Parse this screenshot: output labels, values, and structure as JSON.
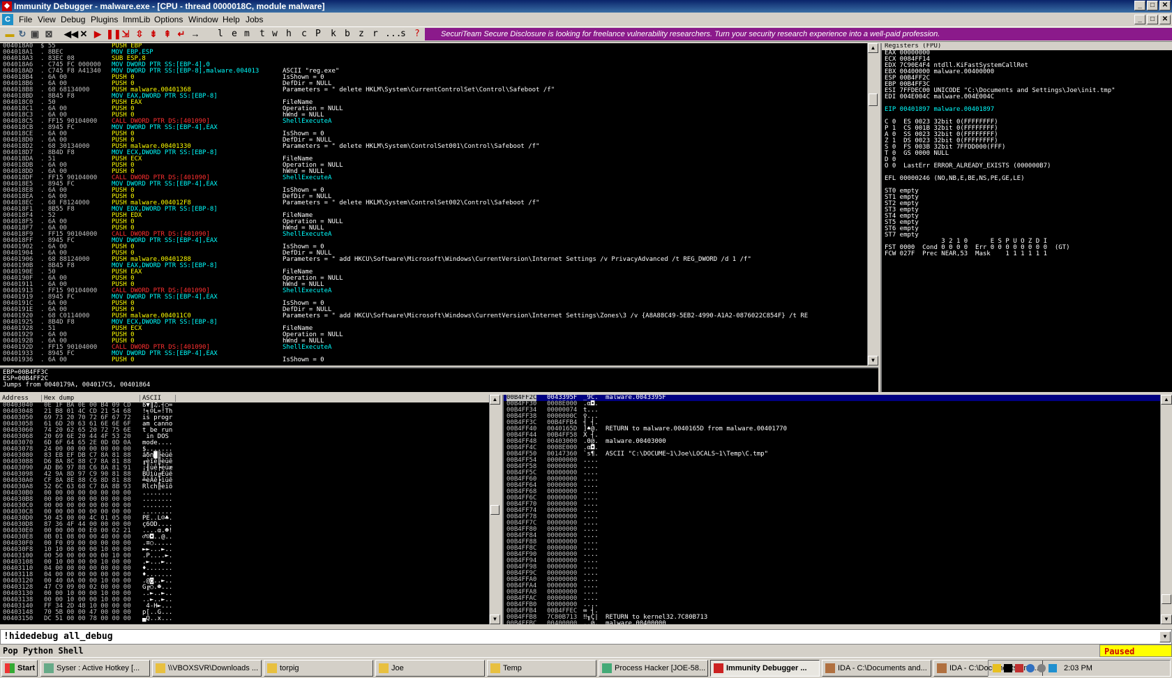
{
  "window": {
    "title": "Immunity Debugger - malware.exe - [CPU - thread 0000018C, module malware]",
    "logo": "C"
  },
  "menu": [
    "File",
    "View",
    "Debug",
    "Plugins",
    "ImmLib",
    "Options",
    "Window",
    "Help",
    "Jobs"
  ],
  "toolbar_letters": [
    "l",
    "e",
    "m",
    "t",
    "w",
    "h",
    "c",
    "P",
    "k",
    "b",
    "z",
    "r",
    "...",
    "s",
    "?"
  ],
  "banner": "SecuriTeam Secure Disclosure is looking for freelance vulnerability researchers. Turn your security research experience into a well-paid profession.",
  "colors": {
    "addr": "#c0c0c0",
    "hex": "#c0c0c0",
    "mnem": "#ffff00",
    "call": "#ff3030",
    "ref": "#00ffff",
    "comment": "#ffffff",
    "highlight_bg": "#000080",
    "registers": "#ffffff"
  },
  "disasm": [
    [
      "004018A0",
      "$ 55",
      "PUSH EBP",
      ""
    ],
    [
      "004018A1",
      ". 8BEC",
      "MOV EBP,ESP",
      ""
    ],
    [
      "004018A3",
      ". 83EC 08",
      "SUB ESP,8",
      ""
    ],
    [
      "004018A6",
      ". C745 FC 000000",
      "MOV DWORD PTR SS:[EBP-4],0",
      ""
    ],
    [
      "004018AD",
      ". C745 F8 A41340",
      "MOV DWORD PTR SS:[EBP-8],malware.004013",
      "ASCII \"reg.exe\""
    ],
    [
      "004018B4",
      ". 6A 00",
      "PUSH 0",
      "IsShown = 0"
    ],
    [
      "004018B6",
      ". 6A 00",
      "PUSH 0",
      "DefDir = NULL"
    ],
    [
      "004018B8",
      ". 68 68134000",
      "PUSH malware.00401368",
      "Parameters = \" delete HKLM\\System\\CurrentControlSet\\Control\\Safeboot /f\""
    ],
    [
      "004018BD",
      ". 8B45 F8",
      "MOV EAX,DWORD PTR SS:[EBP-8]",
      ""
    ],
    [
      "004018C0",
      ". 50",
      "PUSH EAX",
      "FileName"
    ],
    [
      "004018C1",
      ". 6A 00",
      "PUSH 0",
      "Operation = NULL"
    ],
    [
      "004018C3",
      ". 6A 00",
      "PUSH 0",
      "hWnd = NULL"
    ],
    [
      "004018C5",
      ". FF15 90104000",
      "CALL DWORD PTR DS:[401090]",
      "ShellExecuteA"
    ],
    [
      "004018CB",
      ". 8945 FC",
      "MOV DWORD PTR SS:[EBP-4],EAX",
      ""
    ],
    [
      "004018CE",
      ". 6A 00",
      "PUSH 0",
      "IsShown = 0"
    ],
    [
      "004018D0",
      ". 6A 00",
      "PUSH 0",
      "DefDir = NULL"
    ],
    [
      "004018D2",
      ". 68 30134000",
      "PUSH malware.00401330",
      "Parameters = \" delete HKLM\\System\\ControlSet001\\Control\\Safeboot /f\""
    ],
    [
      "004018D7",
      ". 8B4D F8",
      "MOV ECX,DWORD PTR SS:[EBP-8]",
      ""
    ],
    [
      "004018DA",
      ". 51",
      "PUSH ECX",
      "FileName"
    ],
    [
      "004018DB",
      ". 6A 00",
      "PUSH 0",
      "Operation = NULL"
    ],
    [
      "004018DD",
      ". 6A 00",
      "PUSH 0",
      "hWnd = NULL"
    ],
    [
      "004018DF",
      ". FF15 90104000",
      "CALL DWORD PTR DS:[401090]",
      "ShellExecuteA"
    ],
    [
      "004018E5",
      ". 8945 FC",
      "MOV DWORD PTR SS:[EBP-4],EAX",
      ""
    ],
    [
      "004018E8",
      ". 6A 00",
      "PUSH 0",
      "IsShown = 0"
    ],
    [
      "004018EA",
      ". 6A 00",
      "PUSH 0",
      "DefDir = NULL"
    ],
    [
      "004018EC",
      ". 68 F8124000",
      "PUSH malware.004012F8",
      "Parameters = \" delete HKLM\\System\\ControlSet002\\Control\\Safeboot /f\""
    ],
    [
      "004018F1",
      ". 8B55 F8",
      "MOV EDX,DWORD PTR SS:[EBP-8]",
      ""
    ],
    [
      "004018F4",
      ". 52",
      "PUSH EDX",
      "FileName"
    ],
    [
      "004018F5",
      ". 6A 00",
      "PUSH 0",
      "Operation = NULL"
    ],
    [
      "004018F7",
      ". 6A 00",
      "PUSH 0",
      "hWnd = NULL"
    ],
    [
      "004018F9",
      ". FF15 90104000",
      "CALL DWORD PTR DS:[401090]",
      "ShellExecuteA"
    ],
    [
      "004018FF",
      ". 8945 FC",
      "MOV DWORD PTR SS:[EBP-4],EAX",
      ""
    ],
    [
      "00401902",
      ". 6A 00",
      "PUSH 0",
      "IsShown = 0"
    ],
    [
      "00401904",
      ". 6A 00",
      "PUSH 0",
      "DefDir = NULL"
    ],
    [
      "00401906",
      ". 68 88124000",
      "PUSH malware.00401288",
      "Parameters = \" add HKCU\\Software\\Microsoft\\Windows\\CurrentVersion\\Internet Settings /v PrivacyAdvanced /t REG_DWORD /d 1 /f\""
    ],
    [
      "0040190B",
      ". 8B45 F8",
      "MOV EAX,DWORD PTR SS:[EBP-8]",
      ""
    ],
    [
      "0040190E",
      ". 50",
      "PUSH EAX",
      "FileName"
    ],
    [
      "0040190F",
      ". 6A 00",
      "PUSH 0",
      "Operation = NULL"
    ],
    [
      "00401911",
      ". 6A 00",
      "PUSH 0",
      "hWnd = NULL"
    ],
    [
      "00401913",
      ". FF15 90104000",
      "CALL DWORD PTR DS:[401090]",
      "ShellExecuteA"
    ],
    [
      "00401919",
      ". 8945 FC",
      "MOV DWORD PTR SS:[EBP-4],EAX",
      ""
    ],
    [
      "0040191C",
      ". 6A 00",
      "PUSH 0",
      "IsShown = 0"
    ],
    [
      "0040191E",
      ". 6A 00",
      "PUSH 0",
      "DefDir = NULL"
    ],
    [
      "00401920",
      ". 68 C0114000",
      "PUSH malware.004011C0",
      "Parameters = \" add HKCU\\Software\\Microsoft\\Windows\\CurrentVersion\\Internet Settings\\Zones\\3 /v {A8A88C49-5EB2-4990-A1A2-0876022C854F} /t RE"
    ],
    [
      "00401925",
      ". 8B4D F8",
      "MOV ECX,DWORD PTR SS:[EBP-8]",
      ""
    ],
    [
      "00401928",
      ". 51",
      "PUSH ECX",
      "FileName"
    ],
    [
      "00401929",
      ". 6A 00",
      "PUSH 0",
      "Operation = NULL"
    ],
    [
      "0040192B",
      ". 6A 00",
      "PUSH 0",
      "hWnd = NULL"
    ],
    [
      "0040192D",
      ". FF15 90104000",
      "CALL DWORD PTR DS:[401090]",
      "ShellExecuteA"
    ],
    [
      "00401933",
      ". 8945 FC",
      "MOV DWORD PTR SS:[EBP-4],EAX",
      ""
    ],
    [
      "00401936",
      ". 6A 00",
      "PUSH 0",
      "IsShown = 0"
    ]
  ],
  "info": [
    "EBP=00B4FF3C",
    "ESP=00B4FF2C",
    "Jumps from 0040179A, 004017C5, 00401864"
  ],
  "registers_title": "Registers (FPU)",
  "registers": [
    "EAX 00000000",
    "ECX 0084FF14",
    "EDX 7C90E4F4 ntdll.KiFastSystemCallRet",
    "EBX 00400000 malware.00400000",
    "ESP 00B4FF2C",
    "EBP 00B4FF3C",
    "ESI 7FFDEC00 UNICODE \"C:\\Documents and Settings\\Joe\\init.tmp\"",
    "EDI 004E004C malware.004E004C",
    "",
    "EIP 00401897 malware.00401897",
    "",
    "C 0  ES 0023 32bit 0(FFFFFFFF)",
    "P 1  CS 001B 32bit 0(FFFFFFFF)",
    "A 0  SS 0023 32bit 0(FFFFFFFF)",
    "Z 1  DS 0023 32bit 0(FFFFFFFF)",
    "S 0  FS 003B 32bit 7FFDD000(FFF)",
    "T 0  GS 0000 NULL",
    "D 0",
    "O 0  LastErr ERROR_ALREADY_EXISTS (000000B7)",
    "",
    "EFL 00000246 (NO,NB,E,BE,NS,PE,GE,LE)",
    "",
    "ST0 empty",
    "ST1 empty",
    "ST2 empty",
    "ST3 empty",
    "ST4 empty",
    "ST5 empty",
    "ST6 empty",
    "ST7 empty",
    "               3 2 1 0      E S P U O Z D I",
    "FST 0000  Cond 0 0 0 0  Err 0 0 0 0 0 0 0 0  (GT)",
    "FCW 027F  Prec NEAR,53  Mask    1 1 1 1 1 1"
  ],
  "dump_headers": [
    "Address",
    "Hex dump",
    "ASCII"
  ],
  "dump": [
    [
      "00403040",
      "0E 1F BA 0E 00 B4 09 CD",
      "ß▼║♫.┤○="
    ],
    [
      "00403048",
      "21 B8 01 4C CD 21 54 68",
      "!╕☺L=!Th"
    ],
    [
      "00403050",
      "69 73 20 70 72 6F 67 72",
      "is progr"
    ],
    [
      "00403058",
      "61 6D 20 63 61 6E 6E 6F",
      "am canno"
    ],
    [
      "00403060",
      "74 20 62 65 20 72 75 6E",
      "t be run"
    ],
    [
      "00403068",
      "20 69 6E 20 44 4F 53 20",
      " in DOS "
    ],
    [
      "00403070",
      "6D 6F 64 65 2E 0D 0D 0A",
      "mode...."
    ],
    [
      "00403078",
      "24 00 00 00 00 00 00 00",
      "$......."
    ],
    [
      "00403080",
      "83 EB EF DB C7 8A 81 88",
      "âδ∩█╟èüê"
    ],
    [
      "00403088",
      "D6 8A 8C 88 C7 8A 81 88",
      "╓èîê╟èüê"
    ],
    [
      "00403090",
      "AD B6 97 88 C6 8A 81 91",
      "¡╢ùê╞èüæ"
    ],
    [
      "00403098",
      "42 9A 8D 97 C9 90 81 88",
      "BÜìù╔Éüê"
    ],
    [
      "004030A0",
      "CF 8A 8E 88 C6 8D 81 88",
      "╧èÄê╞ìüê"
    ],
    [
      "004030A8",
      "52 6C 63 68 C7 8A 8B 93",
      "Rlch╟èïô"
    ],
    [
      "004030B0",
      "00 00 00 00 00 00 00 00",
      "........"
    ],
    [
      "004030B8",
      "00 00 00 00 00 00 00 00",
      "........"
    ],
    [
      "004030C0",
      "00 00 00 00 00 00 00 00",
      "........"
    ],
    [
      "004030C8",
      "00 00 00 00 00 00 00 00",
      "........"
    ],
    [
      "004030D0",
      "50 45 00 00 4C 01 05 00",
      "PE..L☺♣."
    ],
    [
      "004030D8",
      "87 36 4F 44 00 00 00 00",
      "ç6OD...."
    ],
    [
      "004030E0",
      "00 00 00 00 E0 00 02 21",
      "....α.☻!"
    ],
    [
      "004030E8",
      "0B 01 08 00 00 40 00 00",
      "♂☺◘..@.."
    ],
    [
      "004030F0",
      "00 F0 09 00 00 00 00 00",
      ".≡○....."
    ],
    [
      "004030F8",
      "10 10 00 00 00 10 00 00",
      "►►...►.."
    ],
    [
      "00403100",
      "00 50 00 00 00 00 10 00",
      ".P....►."
    ],
    [
      "00403108",
      "00 10 00 00 00 10 00 00",
      ".►...►.."
    ],
    [
      "00403110",
      "04 00 00 00 00 00 00 00",
      "♦......."
    ],
    [
      "00403118",
      "04 00 00 00 00 00 00 00",
      "♦......."
    ],
    [
      "00403120",
      "00 40 0A 00 00 10 00 00",
      ".@◙..►.."
    ],
    [
      "00403128",
      "47 C9 09 00 02 00 00 00",
      "G╔○.☻..."
    ],
    [
      "00403130",
      "00 00 10 00 00 10 00 00",
      "..►..►.."
    ],
    [
      "00403138",
      "00 00 10 00 00 10 00 00",
      "..►..►.."
    ],
    [
      "00403140",
      "FF 34 2D 48 10 00 00 00",
      " 4-H►..."
    ],
    [
      "00403148",
      "70 5B 00 00 47 00 00 00",
      "p[..G..."
    ],
    [
      "00403150",
      "DC 51 00 00 78 00 00 00",
      "▄Q..x..."
    ]
  ],
  "stack": [
    [
      "00B4FF2C",
      "0043395F",
      "_9C.",
      "malware.0043395F"
    ],
    [
      "00B4FF30",
      "0008E000",
      ".α◘.",
      ""
    ],
    [
      "00B4FF34",
      "00000074",
      "t...",
      ""
    ],
    [
      "00B4FF38",
      "0000000C",
      "♀...",
      ""
    ],
    [
      "00B4FF3C",
      "00B4FFB4",
      "┤ ┤.",
      ""
    ],
    [
      "00B4FF40",
      "0040165D",
      "]♠@.",
      "RETURN to malware.0040165D from malware.00401770"
    ],
    [
      "00B4FF44",
      "00B4FF58",
      "X ┤.",
      ""
    ],
    [
      "00B4FF48",
      "00403000",
      ".0@.",
      "malware.00403000"
    ],
    [
      "00B4FF4C",
      "0008E000",
      ".α◘.",
      ""
    ],
    [
      "00B4FF50",
      "00147360",
      "`s¶.",
      "ASCII \"C:\\DOCUME~1\\Joe\\LOCALS~1\\Temp\\C.tmp\""
    ],
    [
      "00B4FF54",
      "00000000",
      "....",
      ""
    ],
    [
      "00B4FF58",
      "00000000",
      "....",
      ""
    ],
    [
      "00B4FF5C",
      "00000000",
      "....",
      ""
    ],
    [
      "00B4FF60",
      "00000000",
      "....",
      ""
    ],
    [
      "00B4FF64",
      "00000000",
      "....",
      ""
    ],
    [
      "00B4FF68",
      "00000000",
      "....",
      ""
    ],
    [
      "00B4FF6C",
      "00000000",
      "....",
      ""
    ],
    [
      "00B4FF70",
      "00000000",
      "....",
      ""
    ],
    [
      "00B4FF74",
      "00000000",
      "....",
      ""
    ],
    [
      "00B4FF78",
      "00000000",
      "....",
      ""
    ],
    [
      "00B4FF7C",
      "00000000",
      "....",
      ""
    ],
    [
      "00B4FF80",
      "00000000",
      "....",
      ""
    ],
    [
      "00B4FF84",
      "00000000",
      "....",
      ""
    ],
    [
      "00B4FF88",
      "00000000",
      "....",
      ""
    ],
    [
      "00B4FF8C",
      "00000000",
      "....",
      ""
    ],
    [
      "00B4FF90",
      "00000000",
      "....",
      ""
    ],
    [
      "00B4FF94",
      "00000000",
      "....",
      ""
    ],
    [
      "00B4FF98",
      "00000000",
      "....",
      ""
    ],
    [
      "00B4FF9C",
      "00000000",
      "....",
      ""
    ],
    [
      "00B4FFA0",
      "00000000",
      "....",
      ""
    ],
    [
      "00B4FFA4",
      "00000000",
      "....",
      ""
    ],
    [
      "00B4FFA8",
      "00000000",
      "....",
      ""
    ],
    [
      "00B4FFAC",
      "00000000",
      "....",
      ""
    ],
    [
      "00B4FFB0",
      "00000000",
      "....",
      ""
    ],
    [
      "00B4FFB4",
      "00B4FFEC",
      "∞ ┤.",
      ""
    ],
    [
      "00B4FFB8",
      "7C80B713",
      "‼╖Ç|",
      "RETURN to kernel32.7C80B713"
    ],
    [
      "00B4FFBC",
      "00400000",
      "..@.",
      "malware.00400000"
    ]
  ],
  "command": "!hidedebug all_debug",
  "status": "Pop Python Shell",
  "paused": "Paused",
  "taskbar": {
    "start": "Start",
    "items": [
      "Syser : Active Hotkey [...",
      "\\\\VBOXSVR\\Downloads ...",
      "torpig",
      "Joe",
      "Temp",
      "Process Hacker [JOE-58...",
      "Immunity Debugger ...",
      "IDA - C:\\Documents and...",
      "IDA - C:\\Documents and..."
    ],
    "clock": "2:03 PM"
  }
}
